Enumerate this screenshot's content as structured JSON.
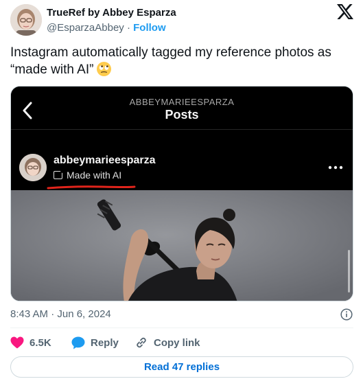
{
  "author": {
    "display_name": "TrueRef by Abbey Esparza",
    "handle": "@EsparzaAbbey",
    "separator": "·",
    "follow_label": "Follow"
  },
  "tweet": {
    "text": "Instagram automatically tagged my reference photos as “made with AI”",
    "emoji_icon": "face-with-rolling-eyes-emoji"
  },
  "embedded_instagram": {
    "account_header": "ABBEYMARIEESPARZA",
    "page_title": "Posts",
    "post_username": "abbeymarieesparza",
    "ai_label": "Made with AI",
    "annotation_color": "#e0241b"
  },
  "meta": {
    "timestamp": "8:43 AM · Jun 6, 2024"
  },
  "actions": {
    "like_count": "6.5K",
    "reply_label": "Reply",
    "copy_link_label": "Copy link"
  },
  "footer": {
    "read_replies_label": "Read 47 replies"
  },
  "colors": {
    "like_red": "#f91880",
    "reply_blue": "#1d9bf0",
    "follow_blue": "#1d9bf0",
    "read_replies_blue": "#006fd6"
  }
}
